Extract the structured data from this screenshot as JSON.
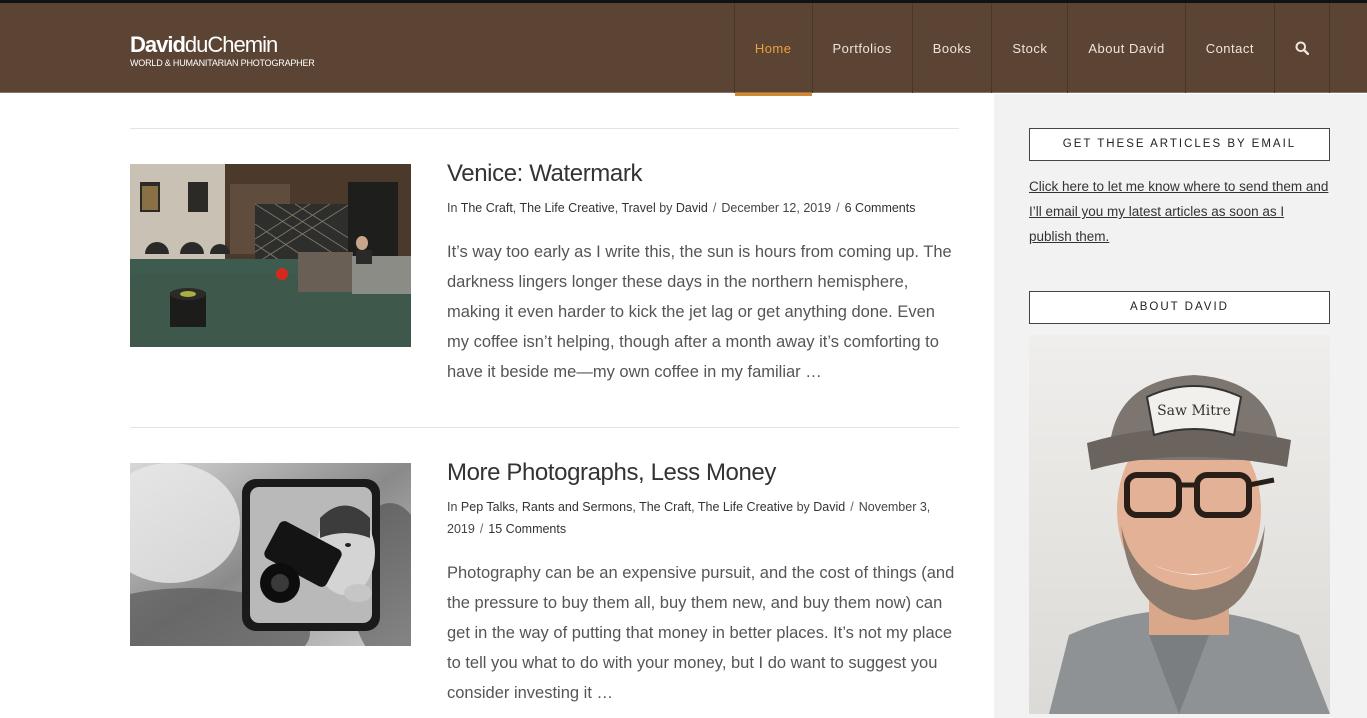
{
  "header": {
    "logo_bold": "David",
    "logo_light": "duChemin",
    "logo_sub": "WORLD & HUMANITARIAN PHOTOGRAPHER",
    "nav": [
      "Home",
      "Portfolios",
      "Books",
      "Stock",
      "About David",
      "Contact"
    ],
    "active_nav": "Home",
    "search_icon": "search-icon"
  },
  "posts": [
    {
      "title": "Venice: Watermark",
      "meta_in": "In",
      "categories": [
        "The Craft",
        "The Life Creative",
        "Travel"
      ],
      "by": "by",
      "author": "David",
      "date": "December 12, 2019",
      "comments": "6 Comments",
      "excerpt": "It’s way too early as I write this, the sun is hours from coming up. The darkness lingers longer these days in the northern hemisphere, making it even harder to kick the jet lag or get anything done. Even my coffee isn’t helping, though after a month away it’s comforting to have it beside me—my own coffee in my familiar …"
    },
    {
      "title": "More Photographs, Less Money",
      "meta_in": "In",
      "categories": [
        "Pep Talks",
        "Rants and Sermons",
        "The Craft",
        "The Life Creative"
      ],
      "by": "by",
      "author": "David",
      "date": "November 3, 2019",
      "comments": "15 Comments",
      "excerpt": "Photography can be an expensive pursuit, and the cost of things (and the pressure to buy them all, buy them new, and buy them now) can get in the way of putting that money in better places. It’s not my place to tell you what to do with your money, but I do want to suggest you consider investing it …"
    }
  ],
  "sidebar": {
    "email_title": "GET THESE ARTICLES BY EMAIL",
    "email_link": "Click here to let me know where to send them and I’ll email you my latest articles as soon as I publish them.",
    "about_title": "ABOUT DAVID"
  },
  "colors": {
    "header_bg": "#5b4434",
    "nav_active": "#e8a13c",
    "sidebar_bg": "#f2f2f2"
  }
}
